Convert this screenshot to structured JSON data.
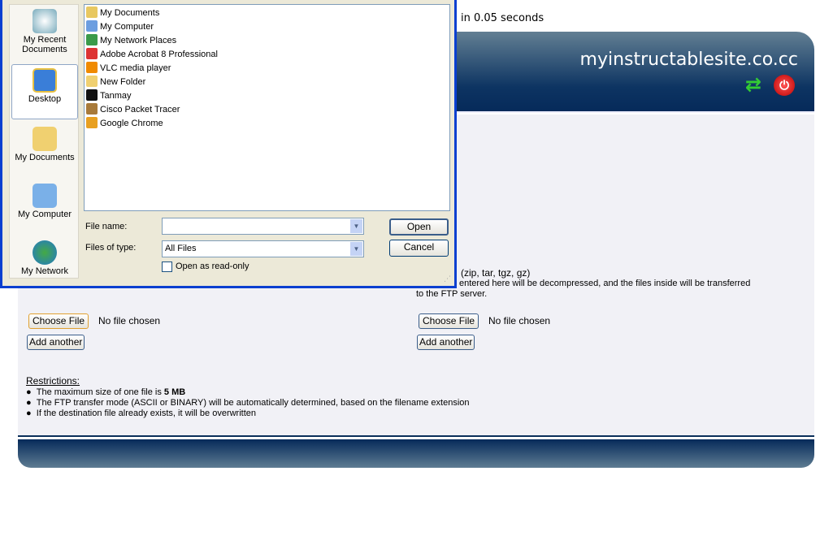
{
  "page": {
    "timing_text": "in 0.05 seconds",
    "site_title": "myinstructablesite.co.cc",
    "header_icons": [
      "refresh-icon",
      "power-icon"
    ],
    "archive_note_line1": "(zip, tar, tgz, gz)",
    "archive_note_line2": "entered here will be decompressed, and the files inside will be transferred",
    "archive_note_line3": "to the FTP server.",
    "left_upload": {
      "choose_label": "Choose File",
      "status": "No file chosen",
      "add_label": "Add another"
    },
    "right_upload": {
      "choose_label": "Choose File",
      "status": "No file chosen",
      "add_label": "Add another"
    },
    "restrictions_title": "Restrictions:",
    "restriction1_prefix": "The maximum size of one file is ",
    "restriction1_bold": "5 MB",
    "restriction2": "The FTP transfer mode (ASCII or BINARY) will be automatically determined, based on the filename extension",
    "restriction3": "If the destination file already exists, it will be overwritten",
    "colors": {
      "header_dark": "#0d3462",
      "header_light": "#627f93",
      "content_bg": "#f1f1f6"
    }
  },
  "dialog": {
    "places": [
      {
        "label": "My Recent Documents",
        "icon": "recent-documents-icon"
      },
      {
        "label": "Desktop",
        "icon": "desktop-icon",
        "selected": true
      },
      {
        "label": "My Documents",
        "icon": "my-documents-icon"
      },
      {
        "label": "My Computer",
        "icon": "my-computer-icon"
      },
      {
        "label": "My Network",
        "icon": "my-network-icon"
      }
    ],
    "files": [
      {
        "name": "My Documents",
        "color": "#e8c860"
      },
      {
        "name": "My Computer",
        "color": "#6c9ee0"
      },
      {
        "name": "My Network Places",
        "color": "#3a9a4a"
      },
      {
        "name": "Adobe Acrobat 8 Professional",
        "color": "#d33"
      },
      {
        "name": "VLC media player",
        "color": "#f08a00"
      },
      {
        "name": "New Folder",
        "color": "#f0d070"
      },
      {
        "name": "Tanmay",
        "color": "#111"
      },
      {
        "name": "Cisco Packet Tracer",
        "color": "#a87a3a"
      },
      {
        "name": "Google Chrome",
        "color": "#e8a020"
      }
    ],
    "file_name_label": "File name:",
    "file_name_value": "",
    "files_of_type_label": "Files of type:",
    "files_of_type_value": "All Files",
    "open_label": "Open",
    "cancel_label": "Cancel",
    "readonly_label": "Open as read-only",
    "readonly_checked": false
  }
}
